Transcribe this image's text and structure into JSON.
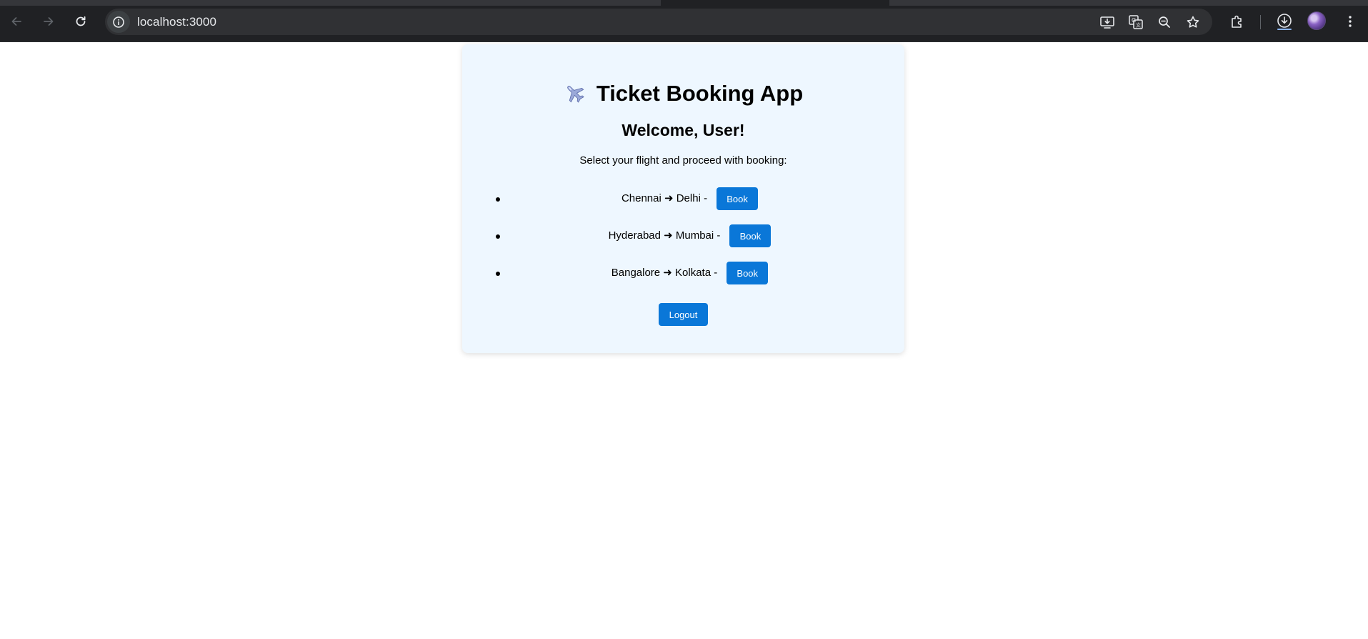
{
  "browser": {
    "url": "localhost:3000",
    "icons": {
      "back": "arrow-left-icon",
      "forward": "arrow-right-icon",
      "reload": "reload-icon",
      "site_info": "info-icon",
      "install": "install-app-icon",
      "translate": "translate-icon",
      "zoom": "zoom-out-icon",
      "bookmark": "star-icon",
      "extensions": "puzzle-icon",
      "downloads": "download-icon",
      "menu": "kebab-menu-icon"
    },
    "colors": {
      "chrome_bg": "#202124",
      "omnibox_bg": "#303134"
    }
  },
  "app": {
    "title_emoji": "airplane-icon",
    "title": "Ticket Booking App",
    "welcome": "Welcome, User!",
    "subtitle": "Select your flight and proceed with booking:",
    "flights": [
      {
        "route": "Chennai ➜ Delhi -",
        "button": "Book"
      },
      {
        "route": "Hyderabad ➜ Mumbai -",
        "button": "Book"
      },
      {
        "route": "Bangalore ➜ Kolkata -",
        "button": "Book"
      }
    ],
    "logout_label": "Logout",
    "colors": {
      "card_bg": "#eef7ff",
      "button_bg": "#0a77d8",
      "button_text": "#ffffff"
    }
  }
}
